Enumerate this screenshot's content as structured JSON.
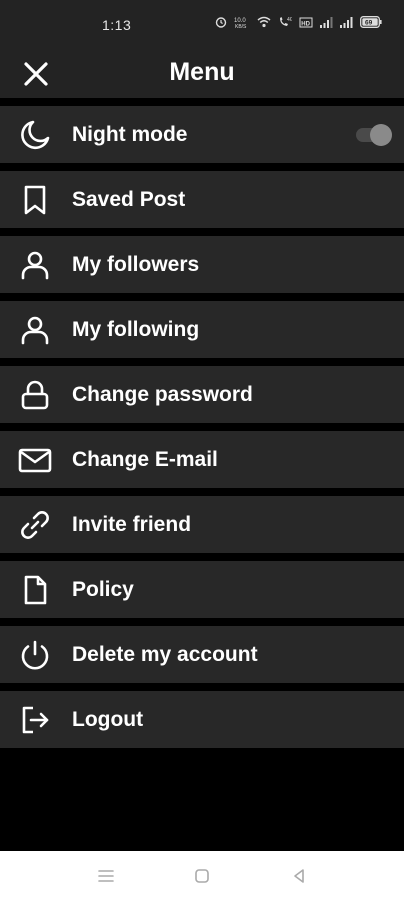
{
  "status_bar": {
    "time": "1:13",
    "icons": [
      "alarm-icon",
      "data-speed-icon",
      "wifi-icon",
      "volte-icon",
      "hd-icon",
      "signal-icon",
      "signal-2-icon",
      "battery-icon"
    ],
    "battery_level": "69"
  },
  "header": {
    "title": "Menu",
    "close_icon": "close-icon"
  },
  "menu": {
    "items": [
      {
        "label": "Night mode",
        "icon": "moon-icon",
        "has_toggle": true,
        "toggle_on": true
      },
      {
        "label": "Saved Post",
        "icon": "bookmark-icon"
      },
      {
        "label": "My followers",
        "icon": "user-icon"
      },
      {
        "label": "My following",
        "icon": "user-icon"
      },
      {
        "label": "Change password",
        "icon": "lock-icon"
      },
      {
        "label": "Change E-mail",
        "icon": "mail-icon"
      },
      {
        "label": "Invite friend",
        "icon": "link-icon"
      },
      {
        "label": "Policy",
        "icon": "document-icon"
      },
      {
        "label": "Delete my account",
        "icon": "power-icon"
      },
      {
        "label": "Logout",
        "icon": "logout-icon"
      }
    ]
  },
  "nav_bar": {
    "buttons": [
      "menu-icon",
      "home-icon",
      "back-icon"
    ]
  },
  "colors": {
    "background": "#000000",
    "bar": "#232323",
    "item_background": "#282828",
    "text": "#ffffff",
    "nav_background": "#ffffff"
  }
}
